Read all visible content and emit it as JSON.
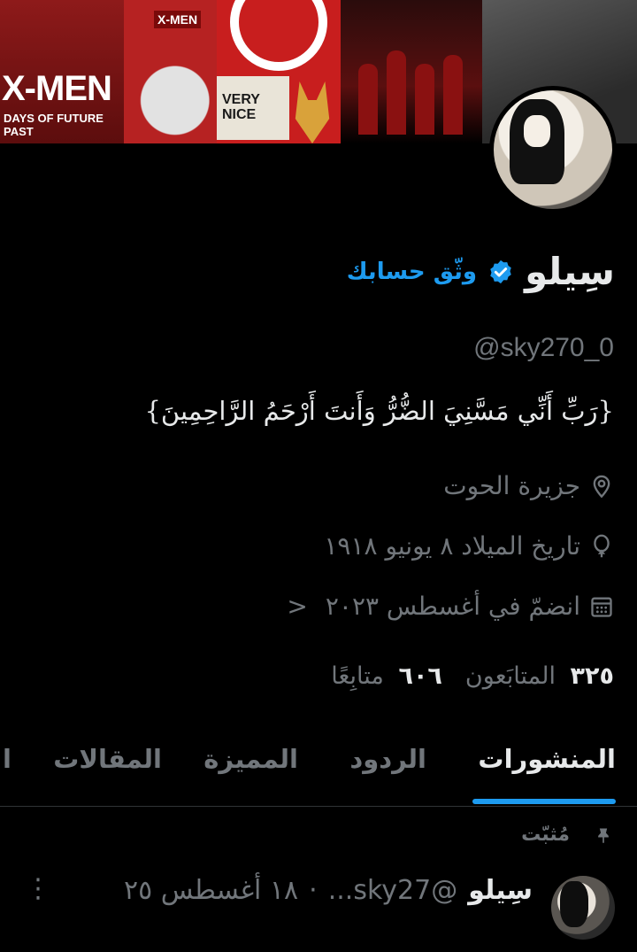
{
  "banner": {
    "poster1_title": "X-MEN",
    "poster1_subtitle": "DAYS OF FUTURE PAST",
    "poster2_logo": "X-MEN",
    "poster3_text": "VERY NICE"
  },
  "profile": {
    "name": "سِيلو",
    "verify_link": "وثّق حسابك",
    "handle": "@sky270_0",
    "bio": "{رَبِّ أَنِّي مَسَّنِيَ الضُّرُّ وَأَنتَ أَرْحَمُ الرَّاحِمِينَ}",
    "location": "جزيرة الحوت",
    "birth": "تاريخ الميلاد ٨ يونيو ١٩١٨",
    "joined": "انضمّ في أغسطس ٢٠٢٣",
    "joined_chevron": "<"
  },
  "stats": {
    "followers_count": "٣٢٥",
    "followers_label": "المتابَعون",
    "following_count": "٦٠٦",
    "following_label": "متابِعًا"
  },
  "tabs": [
    {
      "label": "المنشورات",
      "active": true
    },
    {
      "label": "الردود",
      "active": false
    },
    {
      "label": "المميزة",
      "active": false
    },
    {
      "label": "المقالات",
      "active": false
    },
    {
      "label": "ا",
      "active": false
    }
  ],
  "pinned": {
    "label": "مُثبّت"
  },
  "tweet": {
    "name": "سِيلو",
    "handle": "@sky27...",
    "separator": "·",
    "date": "١٨ أغسطس ٢٥",
    "more": "⋮"
  },
  "colors": {
    "accent": "#1d9bf0",
    "muted": "#71767b",
    "text": "#e7e9ea",
    "bg": "#000000"
  },
  "icons": [
    "location-icon",
    "birthday-balloon-icon",
    "calendar-icon",
    "verified-badge-icon",
    "pin-icon",
    "more-icon"
  ]
}
